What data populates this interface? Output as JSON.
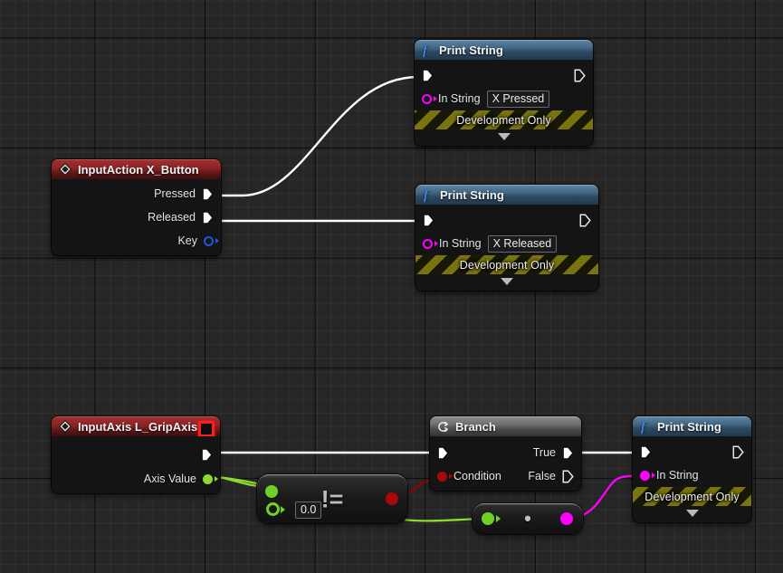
{
  "app": {
    "context": "unreal-engine-blueprint-event-graph",
    "background_color": "#262626",
    "grid_minor_color": "#303030",
    "grid_major_color": "#0a0a0a"
  },
  "colors": {
    "exec_white": "#ffffff",
    "string_magenta": "#ff00ff",
    "float_green": "#8cdb2f",
    "bool_red": "#9c0000",
    "struct_blue": "#1b5ae0",
    "event_red": "#8a2424",
    "function_blue": "#42647f",
    "flow_grey": "#6f6f6f",
    "devonly_yellow": "#7a7410",
    "breakpoint_red": "#ff1d1d"
  },
  "nodes": {
    "input_action_x_button": {
      "title": "InputAction X_Button",
      "type": "event",
      "icon": "diamond-event-icon",
      "pins": [
        {
          "label": "Pressed",
          "kind": "exec-out"
        },
        {
          "label": "Released",
          "kind": "exec-out"
        },
        {
          "label": "Key",
          "kind": "struct-out",
          "color": "#1b5ae0"
        }
      ]
    },
    "print_string_pressed": {
      "title": "Print String",
      "type": "function",
      "icon": "function-f-icon",
      "in_string_label": "In String",
      "in_string_value": "X Pressed",
      "footer": "Development Only"
    },
    "print_string_released": {
      "title": "Print String",
      "type": "function",
      "icon": "function-f-icon",
      "in_string_label": "In String",
      "in_string_value": "X Released",
      "footer": "Development Only"
    },
    "input_axis_l_gripaxis": {
      "title": "InputAxis L_GripAxis",
      "type": "event",
      "icon": "diamond-event-icon",
      "marker": "breakpoint-marker",
      "pins": [
        {
          "label": "",
          "kind": "exec-out"
        },
        {
          "label": "Axis Value",
          "kind": "float-out",
          "color": "#8cdb2f"
        }
      ]
    },
    "branch": {
      "title": "Branch",
      "type": "flow",
      "icon": "branch-loop-icon",
      "condition_label": "Condition",
      "true_label": "True",
      "false_label": "False"
    },
    "print_string_axis": {
      "title": "Print String",
      "type": "function",
      "icon": "function-f-icon",
      "in_string_label": "In String",
      "footer": "Development Only"
    },
    "not_equal": {
      "operator": "!=",
      "name": "not-equal-float",
      "compare_value": "0.0"
    },
    "to_string": {
      "operator": "•",
      "name": "float-to-string-conversion"
    }
  },
  "wires": [
    {
      "from": "input_action_x_button.Pressed",
      "to": "print_string_pressed.exec_in",
      "color": "#ffffff",
      "type": "exec"
    },
    {
      "from": "input_action_x_button.Released",
      "to": "print_string_released.exec_in",
      "color": "#ffffff",
      "type": "exec"
    },
    {
      "from": "input_axis_l_gripaxis.exec_out",
      "to": "branch.exec_in",
      "color": "#ffffff",
      "type": "exec"
    },
    {
      "from": "branch.True",
      "to": "print_string_axis.exec_in",
      "color": "#ffffff",
      "type": "exec"
    },
    {
      "from": "input_axis_l_gripaxis.Axis Value",
      "to": "not_equal.input_a",
      "color": "#8cdb2f",
      "type": "float"
    },
    {
      "from": "input_axis_l_gripaxis.Axis Value",
      "to": "to_string.input",
      "color": "#8cdb2f",
      "type": "float"
    },
    {
      "from": "not_equal.output",
      "to": "branch.Condition",
      "color": "#9c0000",
      "type": "bool"
    },
    {
      "from": "to_string.output",
      "to": "print_string_axis.In String",
      "color": "#ff00ff",
      "type": "string"
    }
  ]
}
